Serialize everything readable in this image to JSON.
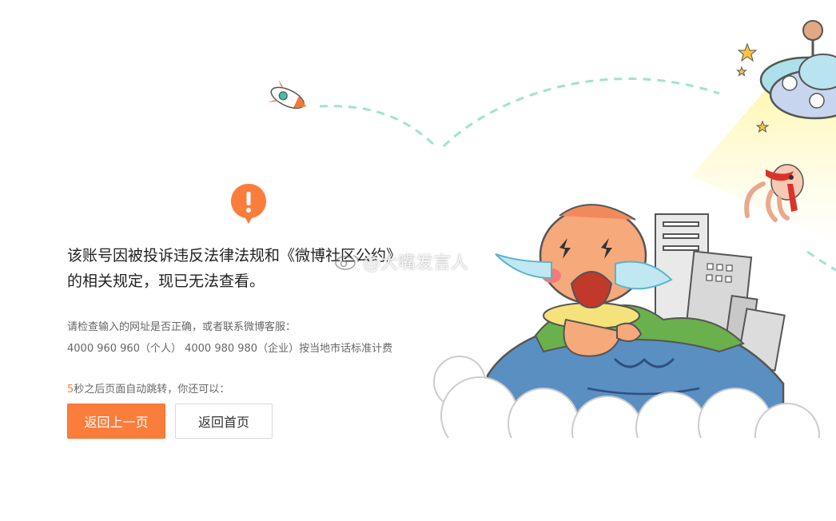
{
  "error": {
    "title_line1": "该账号因被投诉违反法律法规和《微博社区公约》",
    "title_line2": "的相关规定，现已无法查看。",
    "hint_line1": "请检查输入的网址是否正确，或者联系微博客服：",
    "hint_line2": "4000 960 960（个人） 4000 980 980（企业）按当地市话标准计费"
  },
  "redirect": {
    "seconds": "5",
    "text": "秒之后页面自动跳转，你还可以："
  },
  "buttons": {
    "back_label": "返回上一页",
    "home_label": "返回首页"
  },
  "watermark": {
    "text": "@大嘴发言人"
  },
  "colors": {
    "accent": "#fa7d3c",
    "ground": "#5a8fc2",
    "dash": "#9fe3d2"
  },
  "icons": [
    "exclamation-icon",
    "rocket-icon",
    "ufo-icon",
    "weibo-logo-icon"
  ]
}
